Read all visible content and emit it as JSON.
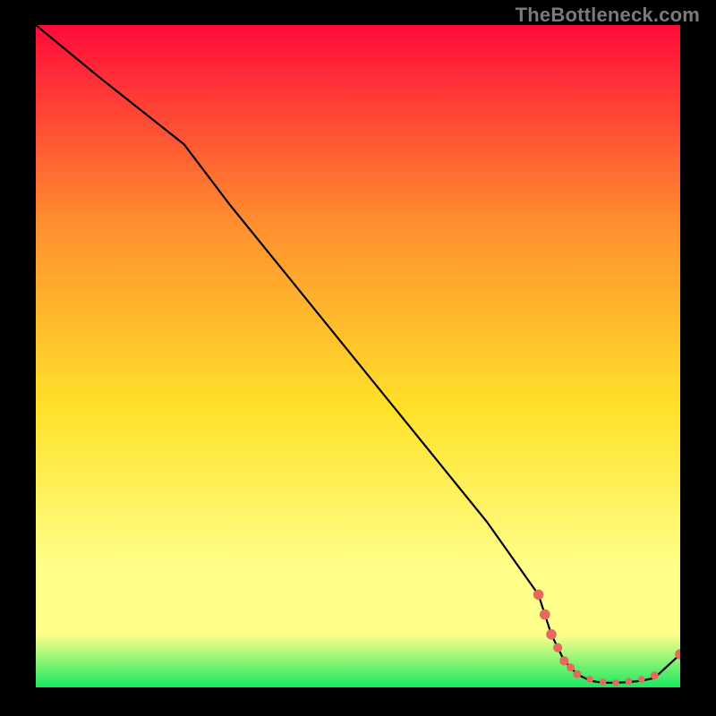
{
  "watermark": "TheBottleneck.com",
  "colors": {
    "background": "#000000",
    "line": "#000000",
    "marker": "#e46a5e",
    "gradient_top": "#ff0a3a",
    "gradient_mid_upper": "#ff8f2f",
    "gradient_mid": "#ffe22a",
    "gradient_mid_lower": "#ffff8a",
    "gradient_bottom": "#18e860"
  },
  "chart_data": {
    "type": "line",
    "title": "",
    "xlabel": "",
    "ylabel": "",
    "xlim": [
      0,
      100
    ],
    "ylim": [
      0,
      100
    ],
    "series": [
      {
        "name": "bottleneck-curve",
        "x": [
          0,
          10,
          23,
          30,
          40,
          50,
          60,
          70,
          78,
          80,
          82,
          84,
          86,
          88,
          90,
          92,
          94,
          96,
          100
        ],
        "y": [
          100,
          92,
          82,
          73,
          61,
          49,
          37,
          25,
          14,
          8,
          4,
          2,
          1,
          0.7,
          0.7,
          0.8,
          1,
          1.4,
          5
        ]
      }
    ],
    "markers": {
      "name": "bottleneck-dots",
      "points": [
        {
          "x": 78,
          "y": 14,
          "r": 1.8
        },
        {
          "x": 79,
          "y": 11,
          "r": 1.8
        },
        {
          "x": 80,
          "y": 8,
          "r": 1.8
        },
        {
          "x": 81,
          "y": 6,
          "r": 1.6
        },
        {
          "x": 82,
          "y": 4,
          "r": 1.6
        },
        {
          "x": 83,
          "y": 3,
          "r": 1.4
        },
        {
          "x": 84,
          "y": 2,
          "r": 1.4
        },
        {
          "x": 86,
          "y": 1.2,
          "r": 1.2
        },
        {
          "x": 88,
          "y": 0.8,
          "r": 1.2
        },
        {
          "x": 90,
          "y": 0.7,
          "r": 1.2
        },
        {
          "x": 92,
          "y": 0.9,
          "r": 1.2
        },
        {
          "x": 94,
          "y": 1.2,
          "r": 1.2
        },
        {
          "x": 96,
          "y": 1.8,
          "r": 1.4
        },
        {
          "x": 100,
          "y": 5,
          "r": 1.8
        }
      ]
    }
  }
}
